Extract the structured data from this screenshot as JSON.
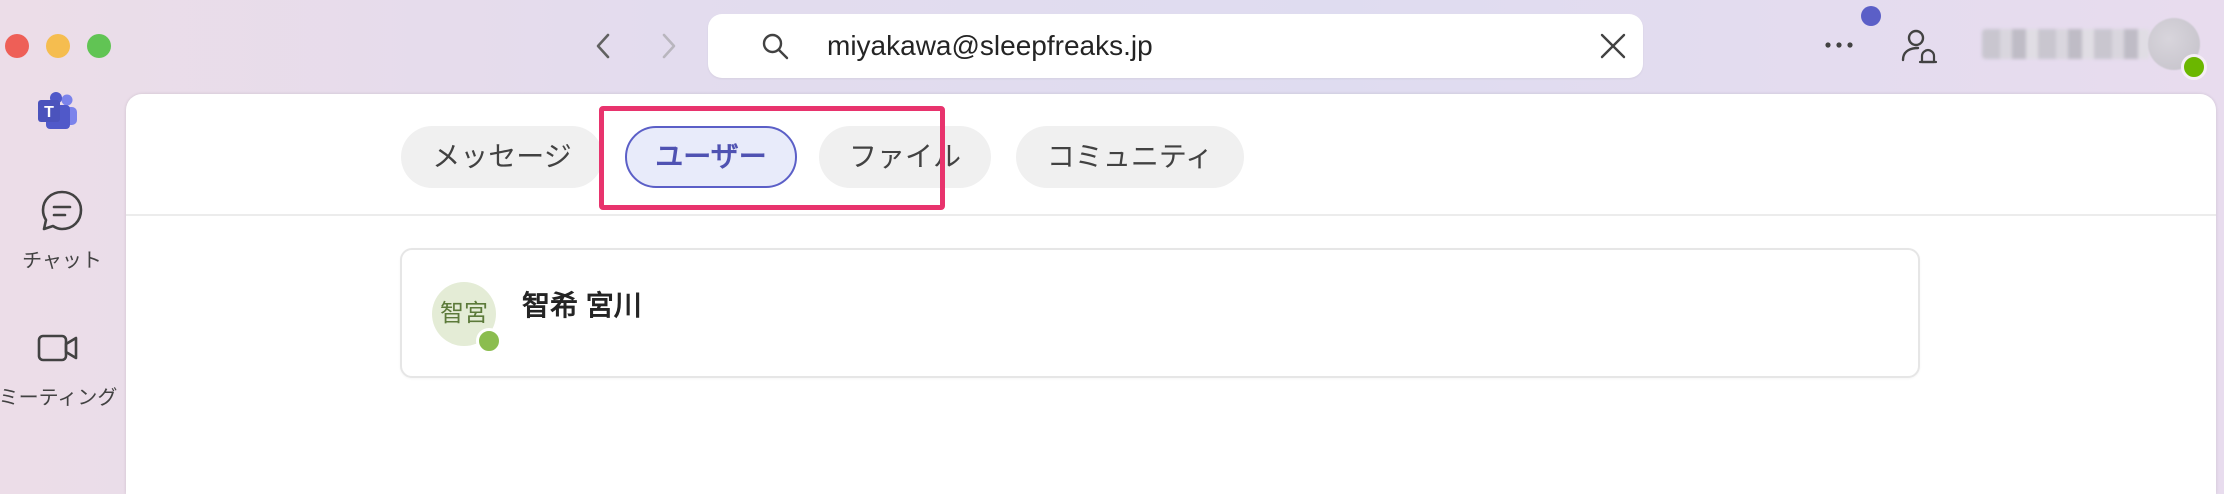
{
  "window": {
    "traffic_lights": [
      "close",
      "minimize",
      "maximize"
    ]
  },
  "toolbar": {
    "back_icon": "chevron-left-icon",
    "forward_icon": "chevron-right-icon",
    "search_value": "miyakawa@sleepfreaks.jp",
    "search_icon": "search-icon",
    "clear_icon": "close-icon",
    "more_icon": "more-horizontal-icon",
    "notification_dot_color": "#5b5fc7",
    "presence_icon": "person-bell-icon"
  },
  "rail": {
    "items": [
      {
        "label": "チャット",
        "icon": "chat-icon"
      },
      {
        "label": "ミーティング",
        "icon": "video-camera-icon"
      }
    ]
  },
  "tabs": [
    {
      "label": "メッセージ",
      "active": false
    },
    {
      "label": "ユーザー",
      "active": true
    },
    {
      "label": "ファイル",
      "active": false
    },
    {
      "label": "コミュニティ",
      "active": false
    }
  ],
  "results": [
    {
      "initials": "智宮",
      "name": "智希 宮川",
      "presence": "available"
    }
  ],
  "colors": {
    "accent": "#5b5fc7",
    "highlight": "#e8336d",
    "available": "#6bb700"
  }
}
